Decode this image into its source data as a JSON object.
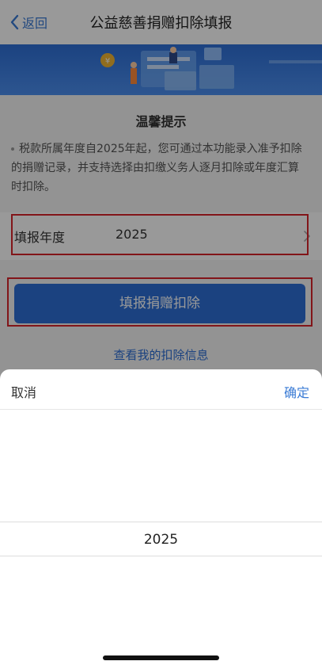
{
  "nav": {
    "back_label": "返回",
    "title": "公益慈善捐赠扣除填报"
  },
  "tips": {
    "title": "温馨提示",
    "text": "税款所属年度自2025年起，您可通过本功能录入准予扣除的捐赠记录，并支持选择由扣缴义务人逐月扣除或年度汇算时扣除。"
  },
  "year_row": {
    "label": "填报年度",
    "value": "2025"
  },
  "submit_label": "填报捐赠扣除",
  "view_link": "查看我的扣除信息",
  "picker": {
    "cancel": "取消",
    "confirm": "确定",
    "selected": "2025"
  },
  "colors": {
    "accent": "#2e6fd6",
    "highlight_border": "#d9232b"
  }
}
